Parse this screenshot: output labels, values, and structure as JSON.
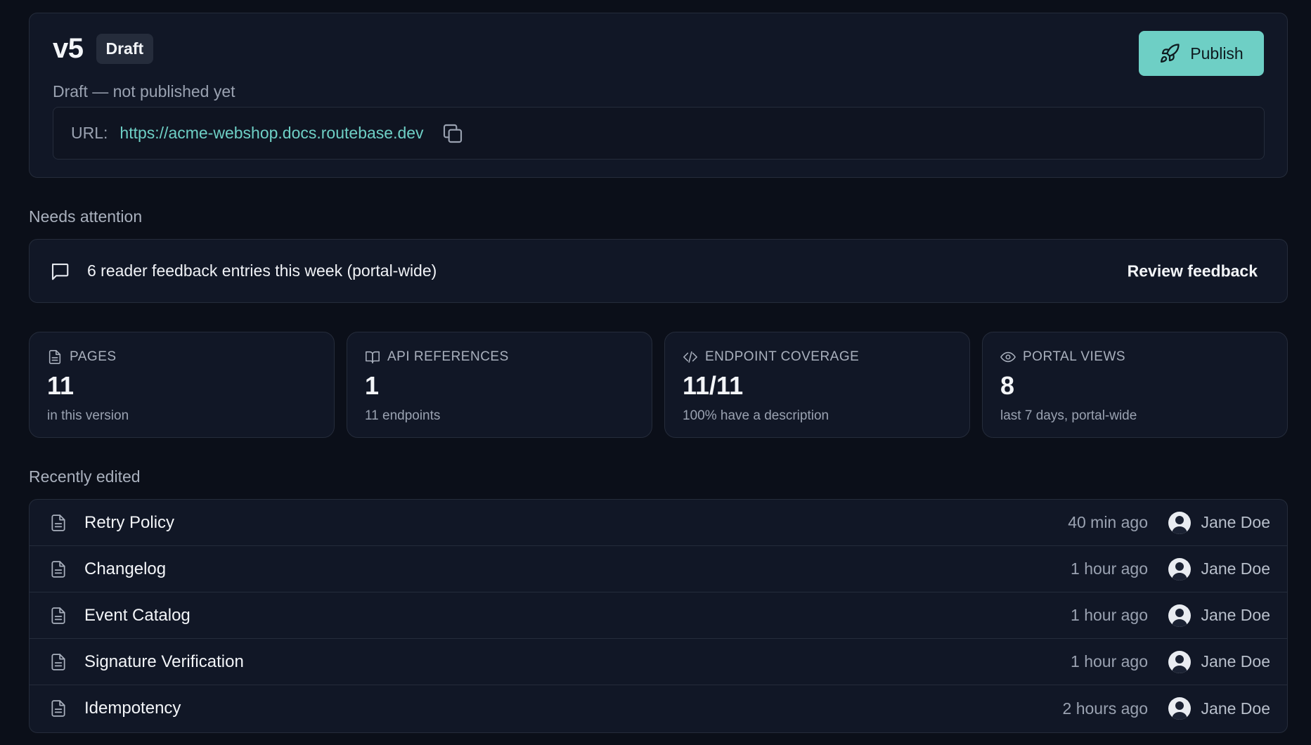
{
  "version": {
    "number": "v5",
    "badge": "Draft",
    "status": "Draft — not published yet",
    "publish_label": "Publish",
    "url_label": "URL:",
    "url": "https://acme-webshop.docs.routebase.dev"
  },
  "needs_attention": {
    "heading": "Needs attention",
    "text": "6 reader feedback entries this week (portal-wide)",
    "action": "Review feedback"
  },
  "stats": [
    {
      "label": "PAGES",
      "value": "11",
      "sub": "in this version",
      "icon": "file-icon"
    },
    {
      "label": "API REFERENCES",
      "value": "1",
      "sub": "11 endpoints",
      "icon": "book-icon"
    },
    {
      "label": "ENDPOINT COVERAGE",
      "value": "11/11",
      "sub": "100% have a description",
      "icon": "code-icon"
    },
    {
      "label": "PORTAL VIEWS",
      "value": "8",
      "sub": "last 7 days, portal-wide",
      "icon": "eye-icon"
    }
  ],
  "recently_edited": {
    "heading": "Recently edited",
    "rows": [
      {
        "title": "Retry Policy",
        "time": "40 min ago",
        "user": "Jane Doe"
      },
      {
        "title": "Changelog",
        "time": "1 hour ago",
        "user": "Jane Doe"
      },
      {
        "title": "Event Catalog",
        "time": "1 hour ago",
        "user": "Jane Doe"
      },
      {
        "title": "Signature Verification",
        "time": "1 hour ago",
        "user": "Jane Doe"
      },
      {
        "title": "Idempotency",
        "time": "2 hours ago",
        "user": "Jane Doe"
      }
    ]
  },
  "colors": {
    "background": "#0b0f19",
    "card": "#111726",
    "accent": "#6ecfc5",
    "border": "#252c3b"
  }
}
